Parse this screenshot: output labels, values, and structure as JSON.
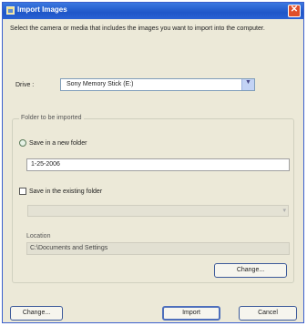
{
  "window": {
    "title": "Import Images",
    "close_glyph": "✕"
  },
  "intro_text": "Select the camera or media that includes the images you want to import into the computer.",
  "drive": {
    "label": "Drive :",
    "value": "Sony Memory Stick (E:)",
    "dropdown_glyph": "▼"
  },
  "folder_group": {
    "label": "Folder to be imported",
    "new_folder_option": "Save in a new folder",
    "new_folder_value": "1-25-2006",
    "existing_folder_option": "Save in the existing folder",
    "existing_dropdown_glyph": "▾",
    "location_label": "Location",
    "location_value": "C:\\Documents and Settings",
    "change_label": "Change..."
  },
  "footer": {
    "change_label": "Change...",
    "import_label": "Import",
    "cancel_label": "Cancel"
  },
  "colors": {
    "titlebar": "#1e56c8",
    "close_button": "#e0502a",
    "dialog_background": "#ece9d8"
  },
  "icons": [
    "window-app-icon",
    "close-icon",
    "chevron-down-icon"
  ]
}
